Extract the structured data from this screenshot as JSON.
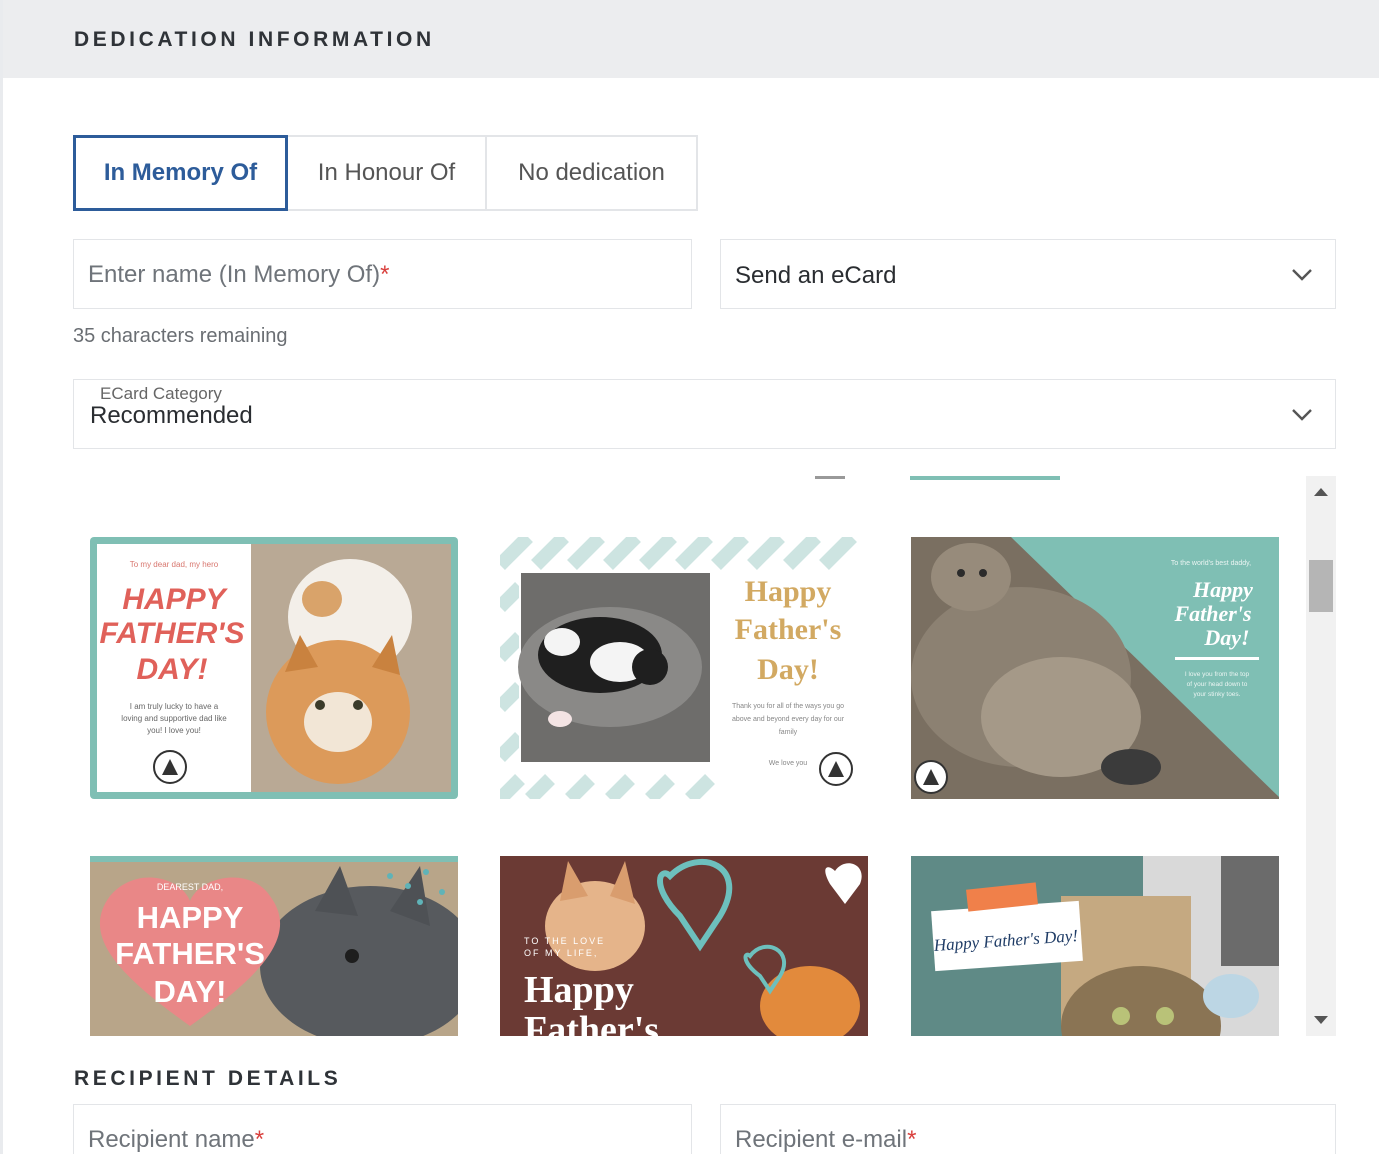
{
  "dedication": {
    "title": "DEDICATION INFORMATION",
    "tabs": [
      {
        "label": "In Memory Of",
        "selected": true
      },
      {
        "label": "In Honour Of",
        "selected": false
      },
      {
        "label": "No dedication",
        "selected": false
      }
    ],
    "name_placeholder": "Enter name (In Memory Of)",
    "required_mark": "*",
    "chars_remaining": "35 characters remaining",
    "send_option": "Send an eCard",
    "ecard_category_label": "ECard Category",
    "ecard_category_value": "Recommended"
  },
  "cards": [
    {
      "lines": [
        "To my dear dad, my hero",
        "HAPPY",
        "FATHER'S",
        "DAY!",
        "I am truly lucky to have a",
        "loving and supportive dad like",
        "you! I love you!"
      ]
    },
    {
      "lines": [
        "Happy",
        "Father's",
        "Day!",
        "Thank you for all of the ways you go",
        "above and beyond every day for our",
        "family",
        "We love you"
      ]
    },
    {
      "lines": [
        "To the world's best daddy,",
        "Happy",
        "Father's",
        "Day!",
        "I love you from the top",
        "of your head down to",
        "your stinky toes."
      ]
    },
    {
      "lines": [
        "DEAREST DAD,",
        "HAPPY",
        "FATHER'S",
        "DAY!"
      ]
    },
    {
      "lines": [
        "TO THE LOVE",
        "OF MY LIFE,",
        "Happy",
        "Father's"
      ]
    },
    {
      "lines": [
        "Happy Father's Day!"
      ]
    }
  ],
  "recipient": {
    "title": "RECIPIENT DETAILS",
    "name_placeholder": "Recipient name",
    "email_placeholder": "Recipient e-mail",
    "required_mark": "*"
  },
  "colors": {
    "accent": "#2d5c9a",
    "required": "#d9403d",
    "teal": "#7fbfb4"
  }
}
